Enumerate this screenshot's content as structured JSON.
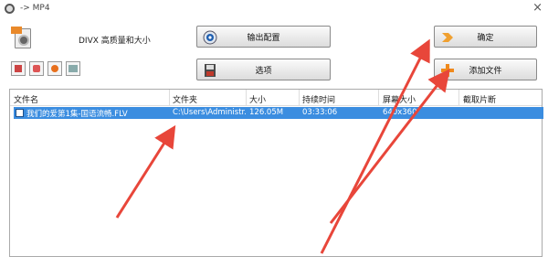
{
  "window": {
    "title": "-> MP4"
  },
  "settings": {
    "quality_label": "DIVX 高质量和大小",
    "output_config_label": "输出配置",
    "options_label": "选项"
  },
  "actions": {
    "confirm_label": "确定",
    "add_file_label": "添加文件"
  },
  "file_list": {
    "columns": [
      "文件名",
      "文件夹",
      "大小",
      "持续时间",
      "屏幕大小",
      "截取片断"
    ],
    "rows": [
      {
        "name": "我们的爱第1集-国语流畅.FLV",
        "folder": "C:\\Users\\Administr...",
        "size": "126.05M",
        "duration": "03:33:06",
        "screen_size": "640x360",
        "clip": ""
      }
    ]
  },
  "colors": {
    "selection": "#3b8de0",
    "arrow": "#e8463a",
    "add_icon": "#f08a1c"
  }
}
